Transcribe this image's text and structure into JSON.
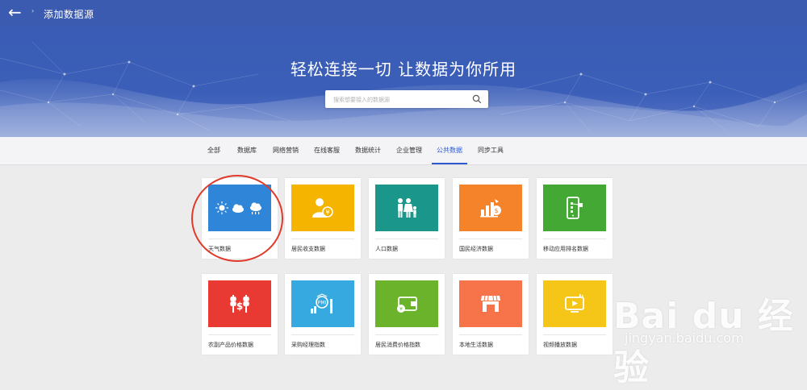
{
  "topbar": {
    "back_icon": "arrow-left-icon",
    "separator": "›",
    "title": "添加数据源"
  },
  "hero": {
    "slogan": "轻松连接一切 让数据为你所用",
    "search": {
      "placeholder": "搜索想要接入的数据源",
      "value": "",
      "icon": "search-icon"
    }
  },
  "tabs": [
    {
      "label": "全部",
      "active": false
    },
    {
      "label": "数据库",
      "active": false
    },
    {
      "label": "网络营销",
      "active": false
    },
    {
      "label": "在线客服",
      "active": false
    },
    {
      "label": "数据统计",
      "active": false
    },
    {
      "label": "企业管理",
      "active": false
    },
    {
      "label": "公共数据",
      "active": true
    },
    {
      "label": "同步工具",
      "active": false
    }
  ],
  "cards": [
    {
      "label": "天气数据",
      "color": "#2f86d9",
      "icon": "weather-icon"
    },
    {
      "label": "居民收支数据",
      "color": "#f5b400",
      "icon": "person-money-icon"
    },
    {
      "label": "人口数据",
      "color": "#1a968a",
      "icon": "family-icon"
    },
    {
      "label": "国民经济数据",
      "color": "#f5832a",
      "icon": "economy-icon"
    },
    {
      "label": "移动应用排名数据",
      "color": "#43a934",
      "icon": "mobile-app-icon"
    },
    {
      "label": "农副产品价格数据",
      "color": "#e83a33",
      "icon": "wheat-price-icon"
    },
    {
      "label": "采购经理指数",
      "color": "#36a9e0",
      "icon": "pmi-icon"
    },
    {
      "label": "居民消费价格指数",
      "color": "#6bb32a",
      "icon": "wallet-icon"
    },
    {
      "label": "本地生活数据",
      "color": "#f7734a",
      "icon": "shop-icon"
    },
    {
      "label": "视频播放数据",
      "color": "#f5c518",
      "icon": "video-play-icon"
    }
  ],
  "watermark": {
    "text": "Bai du 经验",
    "url": "jingyan.baidu.com"
  },
  "colors": {
    "topbar": "#3b5bb0",
    "accent": "#2f5bd0",
    "highlight": "#e03a2a"
  }
}
